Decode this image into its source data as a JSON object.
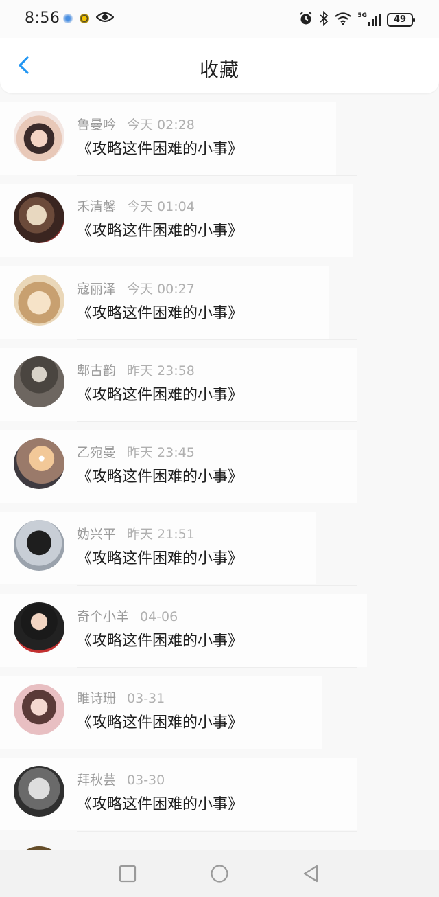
{
  "status_bar": {
    "time": "8:56",
    "network": "5G",
    "battery": "49",
    "icons": [
      "app-notification-icon",
      "app-notification-icon-2",
      "eye-icon",
      "alarm-icon",
      "bluetooth-icon",
      "wifi-icon",
      "signal-icon"
    ]
  },
  "header": {
    "title": "收藏",
    "back_icon": "chevron-left-icon",
    "accent_color": "#2196f3"
  },
  "items": [
    {
      "name": "鲁曼吟",
      "time": "今天 02:28",
      "title": "《攻略这件困难的小事》"
    },
    {
      "name": "禾清馨",
      "time": "今天 01:04",
      "title": "《攻略这件困难的小事》"
    },
    {
      "name": "寇丽泽",
      "time": "今天 00:27",
      "title": "《攻略这件困难的小事》"
    },
    {
      "name": "郫古韵",
      "time": "昨天 23:58",
      "title": "《攻略这件困难的小事》"
    },
    {
      "name": "乙宛曼",
      "time": "昨天 23:45",
      "title": "《攻略这件困难的小事》"
    },
    {
      "name": "妫兴平",
      "time": "昨天 21:51",
      "title": "《攻略这件困难的小事》"
    },
    {
      "name": "奇个小羊",
      "time": "04-06",
      "title": "《攻略这件困难的小事》"
    },
    {
      "name": "睢诗珊",
      "time": "03-31",
      "title": "《攻略这件困难的小事》"
    },
    {
      "name": "拜秋芸",
      "time": "03-30",
      "title": "《攻略这件困难的小事》"
    }
  ],
  "nav_bar": {
    "icons": [
      "square-recents-icon",
      "circle-home-icon",
      "triangle-back-icon"
    ]
  }
}
